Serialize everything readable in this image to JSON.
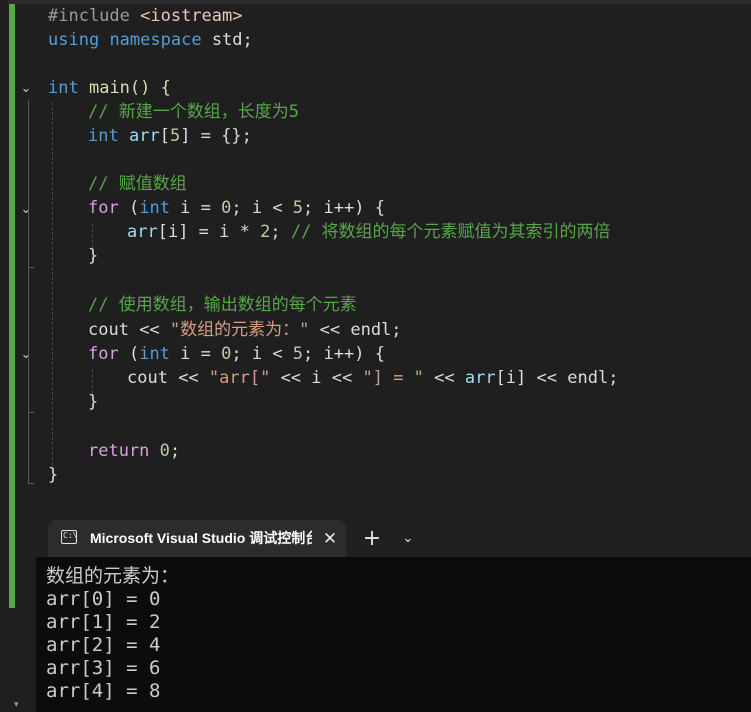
{
  "editor": {
    "include_directive": "#include",
    "include_header": "<iostream>",
    "kw_using": "using",
    "kw_namespace": "namespace",
    "std_text": "std;",
    "kw_int": "int",
    "main_text": "main() {",
    "comment_new_array": "// 新建一个数组，长度为5",
    "arr_name": "arr",
    "arr_size_open": "[",
    "arr_size": "5",
    "arr_decl_rest": "] = {};",
    "comment_assign": "// 赋值数组",
    "kw_for": "for",
    "for_open": "(",
    "for_i_init": " i = ",
    "zero": "0",
    "for_cond": "; i < ",
    "five": "5",
    "for_incr": "; i++) {",
    "assign_index": "[i] = i * ",
    "two": "2",
    "assign_end": ";",
    "comment_assign_detail": "// 将数组的每个元素赋值为其索引的两倍",
    "close_brace": "}",
    "comment_use": "// 使用数组，输出数组的每个元素",
    "cout": "cout",
    "op_shift": " << ",
    "string_header": "\"数组的元素为：\"",
    "endl_semi": "endl;",
    "string_arr_open": "\"arr[\"",
    "var_i": "i",
    "string_close_eq": "\"] = \"",
    "arr_index": "[i]",
    "kw_return": "return",
    "return_end": ";"
  },
  "console": {
    "tab_title": "Microsoft Visual Studio 调试控制台",
    "tab_icon_text": "C:\\",
    "close_glyph": "✕",
    "new_tab_glyph": "+",
    "menu_glyph": "⌄",
    "output": [
      "数组的元素为：",
      "arr[0] = 0",
      "arr[1] = 2",
      "arr[2] = 4",
      "arr[3] = 6",
      "arr[4] = 8"
    ]
  },
  "icons": {
    "fold": "chevron-down-icon",
    "terminal": "terminal-icon",
    "close": "close-icon",
    "add": "plus-icon",
    "dropdown": "chevron-down-icon"
  },
  "colors": {
    "keyword": "#569cd6",
    "control_keyword": "#d8a0df",
    "comment": "#57a64a",
    "string": "#d69d85",
    "number": "#b5cea8",
    "function": "#dcdcaa",
    "variable": "#9cdcfe",
    "change_bar": "#57a64a"
  }
}
